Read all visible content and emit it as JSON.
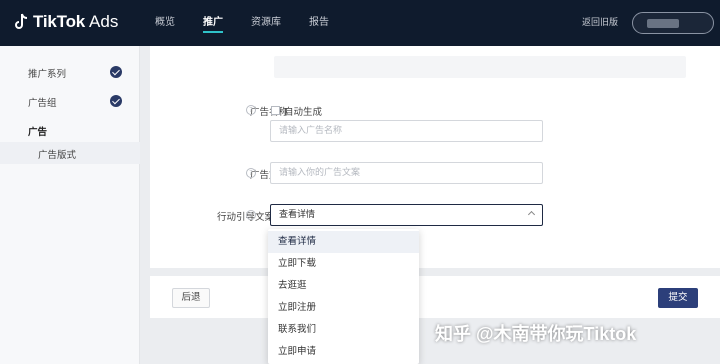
{
  "app": {
    "brand": "TikTok",
    "suffix": "Ads"
  },
  "nav": {
    "items": [
      "概览",
      "推广",
      "资源库",
      "报告"
    ],
    "active_index": 1
  },
  "header": {
    "back_label": "返回旧版"
  },
  "sidebar": {
    "items": [
      {
        "label": "推广系列",
        "completed": true
      },
      {
        "label": "广告组",
        "completed": true
      },
      {
        "label": "广告",
        "completed": false
      }
    ],
    "sub_item": "广告版式"
  },
  "form": {
    "ad_name": {
      "label": "广告名称",
      "auto_label": "自动生成",
      "placeholder": "请输入广告名称"
    },
    "ad_text": {
      "label": "广告文案",
      "placeholder": "请输入你的广告文案"
    },
    "cta": {
      "label": "行动引导文案",
      "value": "查看详情"
    }
  },
  "dropdown": {
    "options": [
      "查看详情",
      "立即下载",
      "去逛逛",
      "立即注册",
      "联系我们",
      "立即申请"
    ],
    "selected_index": 0
  },
  "footer": {
    "back_label": "后退",
    "submit_label": "提交"
  },
  "watermark": "知乎 @木南带你玩Tiktok",
  "colors": {
    "topbar": "#0f1b2d",
    "accent": "#2fc2c9",
    "primary": "#2c3f7a"
  }
}
